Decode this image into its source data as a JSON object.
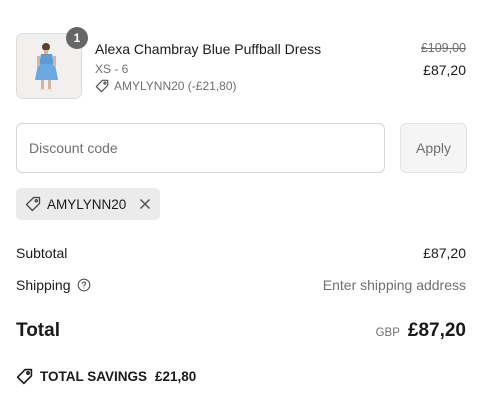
{
  "product": {
    "quantity": "1",
    "name": "Alexa Chambray Blue Puffball Dress",
    "variant": "XS - 6",
    "discount": "AMYLYNN20 (-£21,80)",
    "original_price": "£109,00",
    "price": "£87,20"
  },
  "discount_form": {
    "placeholder": "Discount code",
    "value": "",
    "apply_label": "Apply"
  },
  "applied_code": {
    "code": "AMYLYNN20"
  },
  "summary": {
    "subtotal_label": "Subtotal",
    "subtotal_value": "£87,20",
    "shipping_label": "Shipping",
    "shipping_value": "Enter shipping address",
    "total_label": "Total",
    "currency": "GBP",
    "total_value": "£87,20",
    "savings_label": "TOTAL SAVINGS",
    "savings_value": "£21,80"
  },
  "icons": {
    "tag": "tag-icon",
    "remove": "close-icon",
    "help": "help-circle-icon",
    "savings": "savings-tag-icon"
  }
}
